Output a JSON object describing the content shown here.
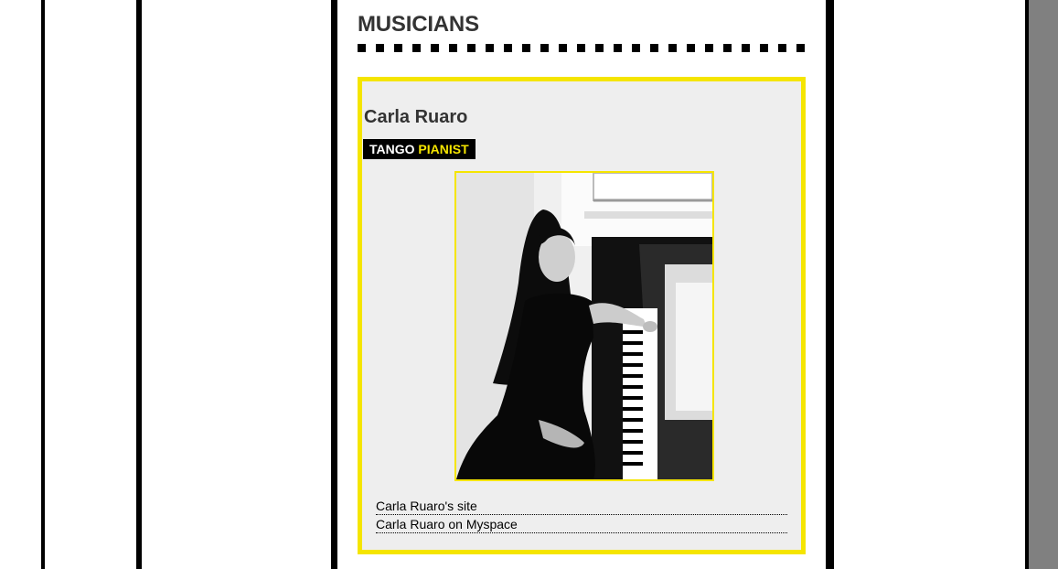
{
  "page": {
    "section_title": "MUSICIANS"
  },
  "musician": {
    "name": "Carla Ruaro",
    "tag_primary": "TANGO",
    "tag_secondary": "PIANIST",
    "photo_alt": "Carla Ruaro",
    "links": [
      {
        "label": "Carla Ruaro's site"
      },
      {
        "label": "Carla Ruaro on Myspace"
      }
    ]
  },
  "colors": {
    "accent": "#f5e500",
    "card_background": "#eeeeee",
    "text": "#333333",
    "rule": "#000000",
    "sidebar_gray": "#808080"
  }
}
